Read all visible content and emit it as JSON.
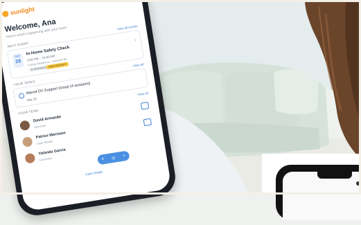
{
  "app": {
    "logo_text": "sunlight",
    "welcome": "Welcome, Ana",
    "welcome_sub": "Here's what's happening with your team"
  },
  "next_event": {
    "section": "NEXT EVENT",
    "view_all": "View all events",
    "month": "SEP",
    "day": "28",
    "title": "In-Home Safety Check",
    "time": "9:00 AM – 10:00 AM",
    "location": "Family Residence · Osborne Rd",
    "tag1": "IN PROGRESS",
    "tag2": "HIGH PRIORITY"
  },
  "tasks": {
    "section": "YOUR TASKS",
    "view_all": "View all",
    "task_title": "Attend DV Support Group (4 sessions)",
    "task_date": "Mar 25"
  },
  "team": {
    "section": "YOUR TEAM",
    "view_all": "View all",
    "members": [
      {
        "name": "David Armando",
        "role": "Advocate",
        "avatar_color": "#7a5a44"
      },
      {
        "name": "Patrice Morrison",
        "role": "Case Worker",
        "avatar_color": "#c59d7a"
      },
      {
        "name": "Yolanda Garcia",
        "role": "Counselor",
        "avatar_color": "#b57c5a"
      }
    ]
  },
  "bottom": {
    "label": "Case Details"
  },
  "icons": {
    "bell": "bell-icon",
    "avatar": "avatar-icon",
    "fab_menu": "menu-icon",
    "fab_chat": "chat-icon",
    "fab_add": "add-icon"
  },
  "colors": {
    "accent": "#4a90e2",
    "brand": "#f5a623",
    "wall": "#e7ece9",
    "couch": "#d7e2da",
    "hair": "#5b3a24"
  }
}
